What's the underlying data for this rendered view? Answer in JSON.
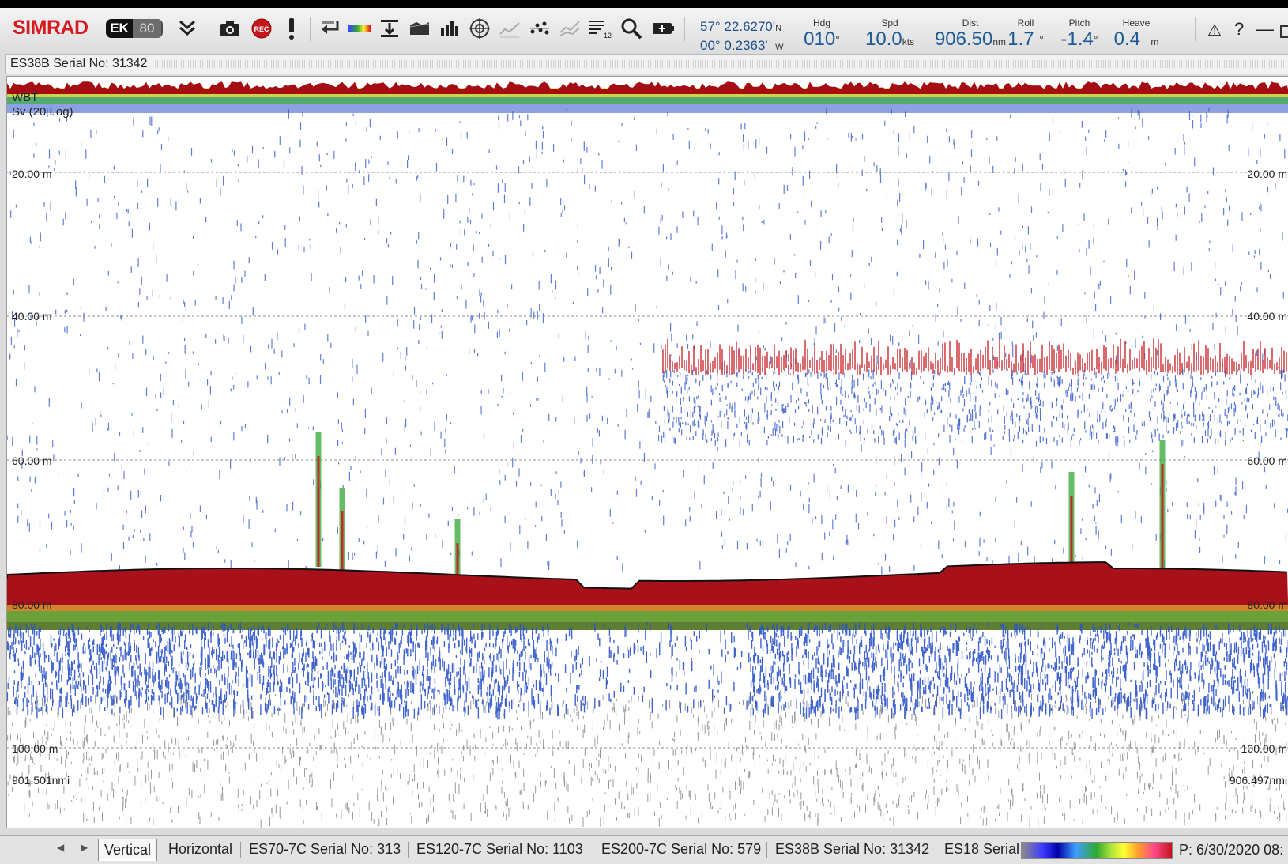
{
  "app": {
    "brand": "SIMRAD",
    "product_badge_left": "EK",
    "product_badge_right": "80"
  },
  "toolbar": {
    "rec_label": "REC",
    "tools": [
      "collapse-chevrons-icon",
      "camera-icon",
      "record-icon",
      "alert-exclamation-icon",
      "arrow-return-icon",
      "color-scale-icon",
      "depth-range-icon",
      "bottom-detect-icon",
      "bar-chart-icon",
      "crosshair-target-icon",
      "line-graph-icon",
      "scatter-plot-icon",
      "multi-trend-icon",
      "numbered-list-icon",
      "magnifier-icon",
      "battery-icon"
    ]
  },
  "navigation": {
    "lat": "57° 22.6270'",
    "lat_hemi": "N",
    "lon": "00° 0.2363'",
    "lon_hemi": "W"
  },
  "readouts": [
    {
      "label": "Hdg",
      "value": "010",
      "unit": "°"
    },
    {
      "label": "Spd",
      "value": "10.0",
      "unit": "kts"
    },
    {
      "label": "Dist",
      "value": "906.50",
      "unit": "nm"
    },
    {
      "label": "Roll",
      "value": "1.7",
      "unit": "°"
    },
    {
      "label": "Pitch",
      "value": "-1.4",
      "unit": "°"
    },
    {
      "label": "Heave",
      "value": "0.4",
      "unit": "m"
    }
  ],
  "window_controls": {
    "warning": "⚠",
    "help": "?",
    "minimize": "—"
  },
  "panel": {
    "title": "ES38B Serial No: 31342"
  },
  "echogram": {
    "channel_label": "WBT",
    "variable_label": "Sv (20 Log)",
    "depth_ticks": [
      {
        "label": "20.00 m",
        "depth_m": 20
      },
      {
        "label": "40.00 m",
        "depth_m": 40
      },
      {
        "label": "60.00 m",
        "depth_m": 60
      },
      {
        "label": "80.00 m",
        "depth_m": 80
      },
      {
        "label": "100.00 m",
        "depth_m": 100
      }
    ],
    "right_depth_ticks": [
      "20.00 m",
      "40.00 m",
      "60.00 m",
      "80.00 m",
      "100.00 m"
    ],
    "start_distance": "901.501nmi",
    "end_distance": "906.497nmi",
    "colors": {
      "surface": "#a50d12",
      "bottom": "#a9111a",
      "school": "#c9262c",
      "blue_echo": "#2c53c8",
      "green_echo": "#3fae3f",
      "yellow_echo": "#f0e43a"
    }
  },
  "tabs": {
    "items": [
      {
        "label": "Vertical",
        "active": true
      },
      {
        "label": "Horizontal",
        "active": false
      },
      {
        "label": "ES70-7C Serial No: 313",
        "active": false
      },
      {
        "label": "ES120-7C Serial No: 1103",
        "active": false
      },
      {
        "label": "ES200-7C Serial No: 579",
        "active": false
      },
      {
        "label": "ES38B Serial No: 31342",
        "active": false
      },
      {
        "label": "ES18 Serial",
        "active": false
      }
    ],
    "status": "P: 6/30/2020  08:"
  }
}
